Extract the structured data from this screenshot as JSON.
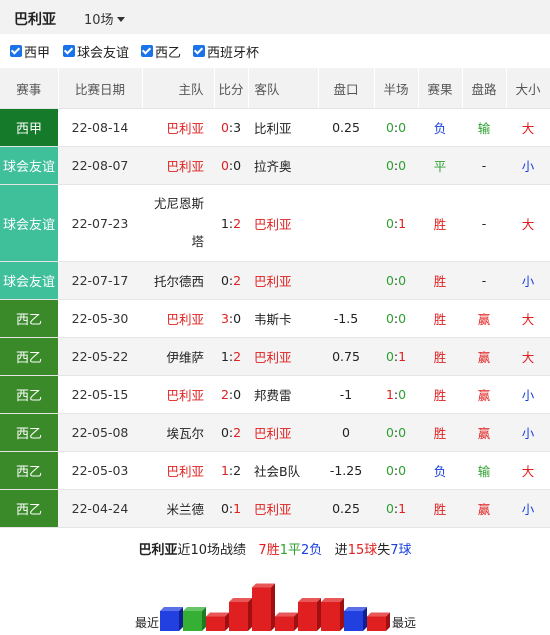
{
  "header": {
    "team": "巴利亚",
    "count": "10场"
  },
  "filters": [
    "西甲",
    "球会友谊",
    "西乙",
    "西班牙杯"
  ],
  "columns": [
    "赛事",
    "比赛日期",
    "主队",
    "比分",
    "客队",
    "盘口",
    "半场",
    "赛果",
    "盘路",
    "大小"
  ],
  "colors": {
    "laliga": "#157a2a",
    "friendly": "#3fbf9a",
    "segunda": "#3a8a2a",
    "red": "#e02020",
    "green": "#2ea030",
    "blue": "#1a40e0"
  },
  "matches": [
    {
      "league": "西甲",
      "date": "22-08-14",
      "home": "巴利亚",
      "hs": "0",
      "as": "3",
      "away": "比利亚",
      "hcap": "0.25",
      "hh": "0",
      "ha": "0",
      "result": "负",
      "handicap": "输",
      "ou": "大"
    },
    {
      "league": "球会友谊",
      "date": "22-08-07",
      "home": "巴利亚",
      "hs": "0",
      "as": "0",
      "away": "拉齐奥",
      "hcap": "",
      "hh": "0",
      "ha": "0",
      "result": "平",
      "handicap": "-",
      "ou": "小"
    },
    {
      "league": "球会友谊",
      "date": "22-07-23",
      "home": "尤尼恩斯塔",
      "hs": "1",
      "as": "2",
      "away": "巴利亚",
      "hcap": "",
      "hh": "0",
      "ha": "1",
      "result": "胜",
      "handicap": "-",
      "ou": "大"
    },
    {
      "league": "球会友谊",
      "date": "22-07-17",
      "home": "托尔德西",
      "hs": "0",
      "as": "2",
      "away": "巴利亚",
      "hcap": "",
      "hh": "0",
      "ha": "0",
      "result": "胜",
      "handicap": "-",
      "ou": "小"
    },
    {
      "league": "西乙",
      "date": "22-05-30",
      "home": "巴利亚",
      "hs": "3",
      "as": "0",
      "away": "韦斯卡",
      "hcap": "-1.5",
      "hh": "0",
      "ha": "0",
      "result": "胜",
      "handicap": "赢",
      "ou": "大"
    },
    {
      "league": "西乙",
      "date": "22-05-22",
      "home": "伊维萨",
      "hs": "1",
      "as": "2",
      "away": "巴利亚",
      "hcap": "0.75",
      "hh": "0",
      "ha": "1",
      "result": "胜",
      "handicap": "赢",
      "ou": "大"
    },
    {
      "league": "西乙",
      "date": "22-05-15",
      "home": "巴利亚",
      "hs": "2",
      "as": "0",
      "away": "邦费雷",
      "hcap": "-1",
      "hh": "1",
      "ha": "0",
      "result": "胜",
      "handicap": "赢",
      "ou": "小"
    },
    {
      "league": "西乙",
      "date": "22-05-08",
      "home": "埃瓦尔",
      "hs": "0",
      "as": "2",
      "away": "巴利亚",
      "hcap": "0",
      "hh": "0",
      "ha": "0",
      "result": "胜",
      "handicap": "赢",
      "ou": "小"
    },
    {
      "league": "西乙",
      "date": "22-05-03",
      "home": "巴利亚",
      "hs": "1",
      "as": "2",
      "away": "社会B队",
      "hcap": "-1.25",
      "hh": "0",
      "ha": "0",
      "result": "负",
      "handicap": "输",
      "ou": "大"
    },
    {
      "league": "西乙",
      "date": "22-04-24",
      "home": "米兰德",
      "hs": "0",
      "as": "1",
      "away": "巴利亚",
      "hcap": "0.25",
      "hh": "0",
      "ha": "1",
      "result": "胜",
      "handicap": "赢",
      "ou": "小"
    }
  ],
  "summary": {
    "team": "巴利亚",
    "pre": "近10场战绩",
    "w": "7胜",
    "d": "1平",
    "l": "2负",
    "goals_pre": "进",
    "gf": "15球",
    "ga_pre": "失",
    "ga": "7球"
  },
  "bars": {
    "left_label": "最近",
    "right_label": "最远",
    "goal_diff": [
      -3,
      0,
      1,
      2,
      3,
      1,
      2,
      2,
      -1,
      1
    ]
  }
}
